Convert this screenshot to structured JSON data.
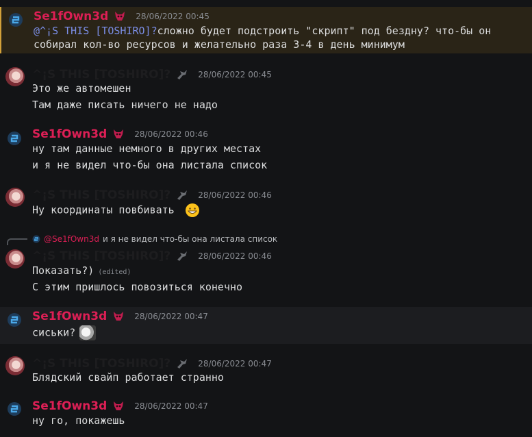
{
  "users": {
    "se": "Se1fOwn3d",
    "toshi": "^¡S THIS [TOSHIRO]?"
  },
  "messages": [
    {
      "time": "28/06/2022 00:45",
      "mention": "@^¡S THIS [TOSHIRO]?",
      "line1": "сложно будет подстроить \"скрипт\" под бездну? что-бы он",
      "line2": "собирал кол-во ресурсов и желательно раза 3-4 в день минимум"
    },
    {
      "time": "28/06/2022 00:45",
      "line1": "Это же автомешен",
      "line2": "Там даже писать ничего не надо"
    },
    {
      "time": "28/06/2022 00:46",
      "line1": "ну там данные немного в других местах",
      "line2": "и я не видел что-бы она листала список"
    },
    {
      "time": "28/06/2022 00:46",
      "line1": "Ну координаты повбивать"
    },
    {
      "time": "28/06/2022 00:46",
      "reply_name": "@Se1fOwn3d",
      "reply_text": "и я не видел что-бы она листала список",
      "line1": "Показать?)",
      "edited": "(edited)",
      "line2": "С этим пришлось повозиться конечно"
    },
    {
      "time": "28/06/2022 00:47",
      "line1": "сиськи?"
    },
    {
      "time": "28/06/2022 00:47",
      "line1": "Блядский свайп работает странно"
    },
    {
      "time": "28/06/2022 00:47",
      "line1": "ну го, покажешь"
    }
  ],
  "colors": {
    "accent_red": "#dc1f55",
    "mention_blue": "#7b8ee6",
    "mention_bg": "#2a2417",
    "background": "#131416"
  },
  "icons": {
    "se_avatar": "sky-logo-icon",
    "toshi_avatar": "anime-avatar",
    "se_badge": "demon-mask-icon",
    "toshi_badge": "dragon-icon",
    "emoji": "grinning-face-emoji",
    "sticker": "cat-emoji"
  }
}
